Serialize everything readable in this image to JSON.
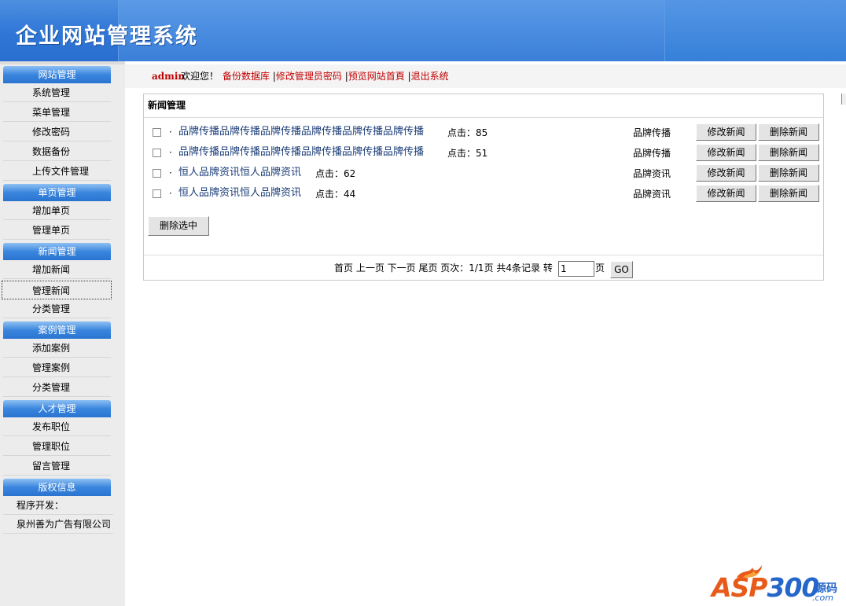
{
  "header": {
    "title": "企业网站管理系统"
  },
  "sidebar": {
    "groups": [
      {
        "label": "网站管理",
        "items": [
          "系统管理",
          "菜单管理",
          "修改密码",
          "数据备份",
          "上传文件管理"
        ]
      },
      {
        "label": "单页管理",
        "items": [
          "增加单页",
          "管理单页"
        ]
      },
      {
        "label": "新闻管理",
        "items": [
          "增加新闻",
          "管理新闻",
          "分类管理"
        ]
      },
      {
        "label": "案例管理",
        "items": [
          "添加案例",
          "管理案例",
          "分类管理"
        ]
      },
      {
        "label": "人才管理",
        "items": [
          "发布职位",
          "管理职位",
          "留言管理"
        ]
      },
      {
        "label": "版权信息",
        "items": [
          "程序开发：",
          "泉州善为广告有限公司"
        ]
      }
    ],
    "active_item": "管理新闻"
  },
  "topbar": {
    "user": "admin",
    "welcome": "欢迎您！",
    "links": [
      "备份数据库",
      "修改管理员密码",
      "预览网站首頁",
      "退出系统"
    ],
    "separator": "|"
  },
  "panel": {
    "title": "新闻管理",
    "rows": [
      {
        "title": "品牌传播品牌传播品牌传播品牌传播品牌传播品牌传播",
        "clicks_label": "点击：85",
        "category": "品牌传播",
        "edit_label": "修改新闻",
        "delete_label": "删除新闻"
      },
      {
        "title": "品牌传播品牌传播品牌传播品牌传播品牌传播品牌传播",
        "clicks_label": "点击：51",
        "category": "品牌传播",
        "edit_label": "修改新闻",
        "delete_label": "删除新闻"
      },
      {
        "title": "恒人品牌资讯恒人品牌资讯",
        "clicks_label": "点击：62",
        "category": "品牌资讯",
        "edit_label": "修改新闻",
        "delete_label": "删除新闻"
      },
      {
        "title": "恒人品牌资讯恒人品牌资讯",
        "clicks_label": "点击：44",
        "category": "品牌资讯",
        "edit_label": "修改新闻",
        "delete_label": "删除新闻"
      }
    ],
    "bullet": "·",
    "delete_selected_label": "删除选中",
    "pager": {
      "text": "首页  上一页  下一页  尾页  页次：1/1页  共4条记录  转",
      "page_value": "1",
      "page_suffix": "页",
      "go_label": "GO"
    }
  },
  "watermark": {
    "brand_a": "ASP",
    "brand_b": "300",
    "suffix_top": "源码",
    "suffix_bottom": ".com"
  }
}
